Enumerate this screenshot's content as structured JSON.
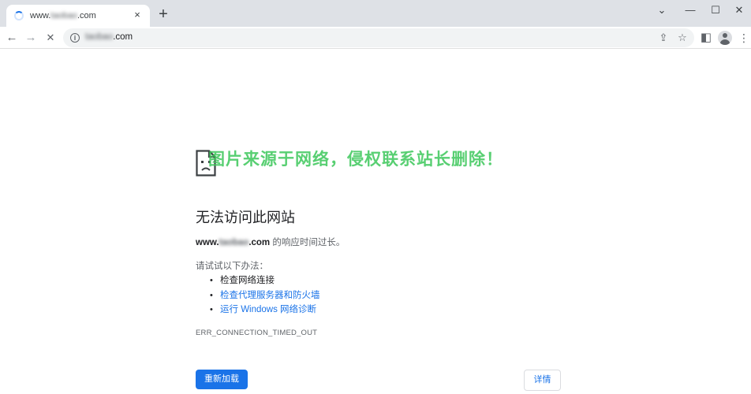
{
  "browser": {
    "tab": {
      "title_prefix": "www.",
      "title_blurred": "taobao",
      "title_suffix": ".com",
      "close_icon": "×"
    },
    "new_tab_icon": "+",
    "window_controls": {
      "minimize": "⌄",
      "restore": "—",
      "maximize": "☐",
      "close": "✕"
    },
    "toolbar": {
      "back_icon": "←",
      "forward_icon": "→",
      "stop_icon": "✕",
      "url_blurred": "taobao",
      "url_suffix": ".com",
      "share_icon": "⇪",
      "bookmark_icon": "☆",
      "sidepanel_icon": "◧",
      "menu_icon": "⋮"
    }
  },
  "error_page": {
    "watermark": "图片来源于网络，侵权联系站长删除！",
    "title": "无法访问此网站",
    "desc_host_prefix": "www.",
    "desc_host_blurred": "taobao",
    "desc_host_suffix": ".com",
    "desc_text": " 的响应时间过长。",
    "try_label": "请试试以下办法：",
    "suggestions": [
      {
        "text": "检查网络连接",
        "link": false
      },
      {
        "text": "检查代理服务器和防火墙",
        "link": true
      },
      {
        "text": "运行 Windows 网络诊断",
        "link": true
      }
    ],
    "error_code": "ERR_CONNECTION_TIMED_OUT",
    "reload_label": "重新加载",
    "details_label": "详情"
  },
  "colors": {
    "accent": "#1a73e8",
    "tab_strip": "#dee1e6",
    "watermark": "#3cc75a"
  }
}
